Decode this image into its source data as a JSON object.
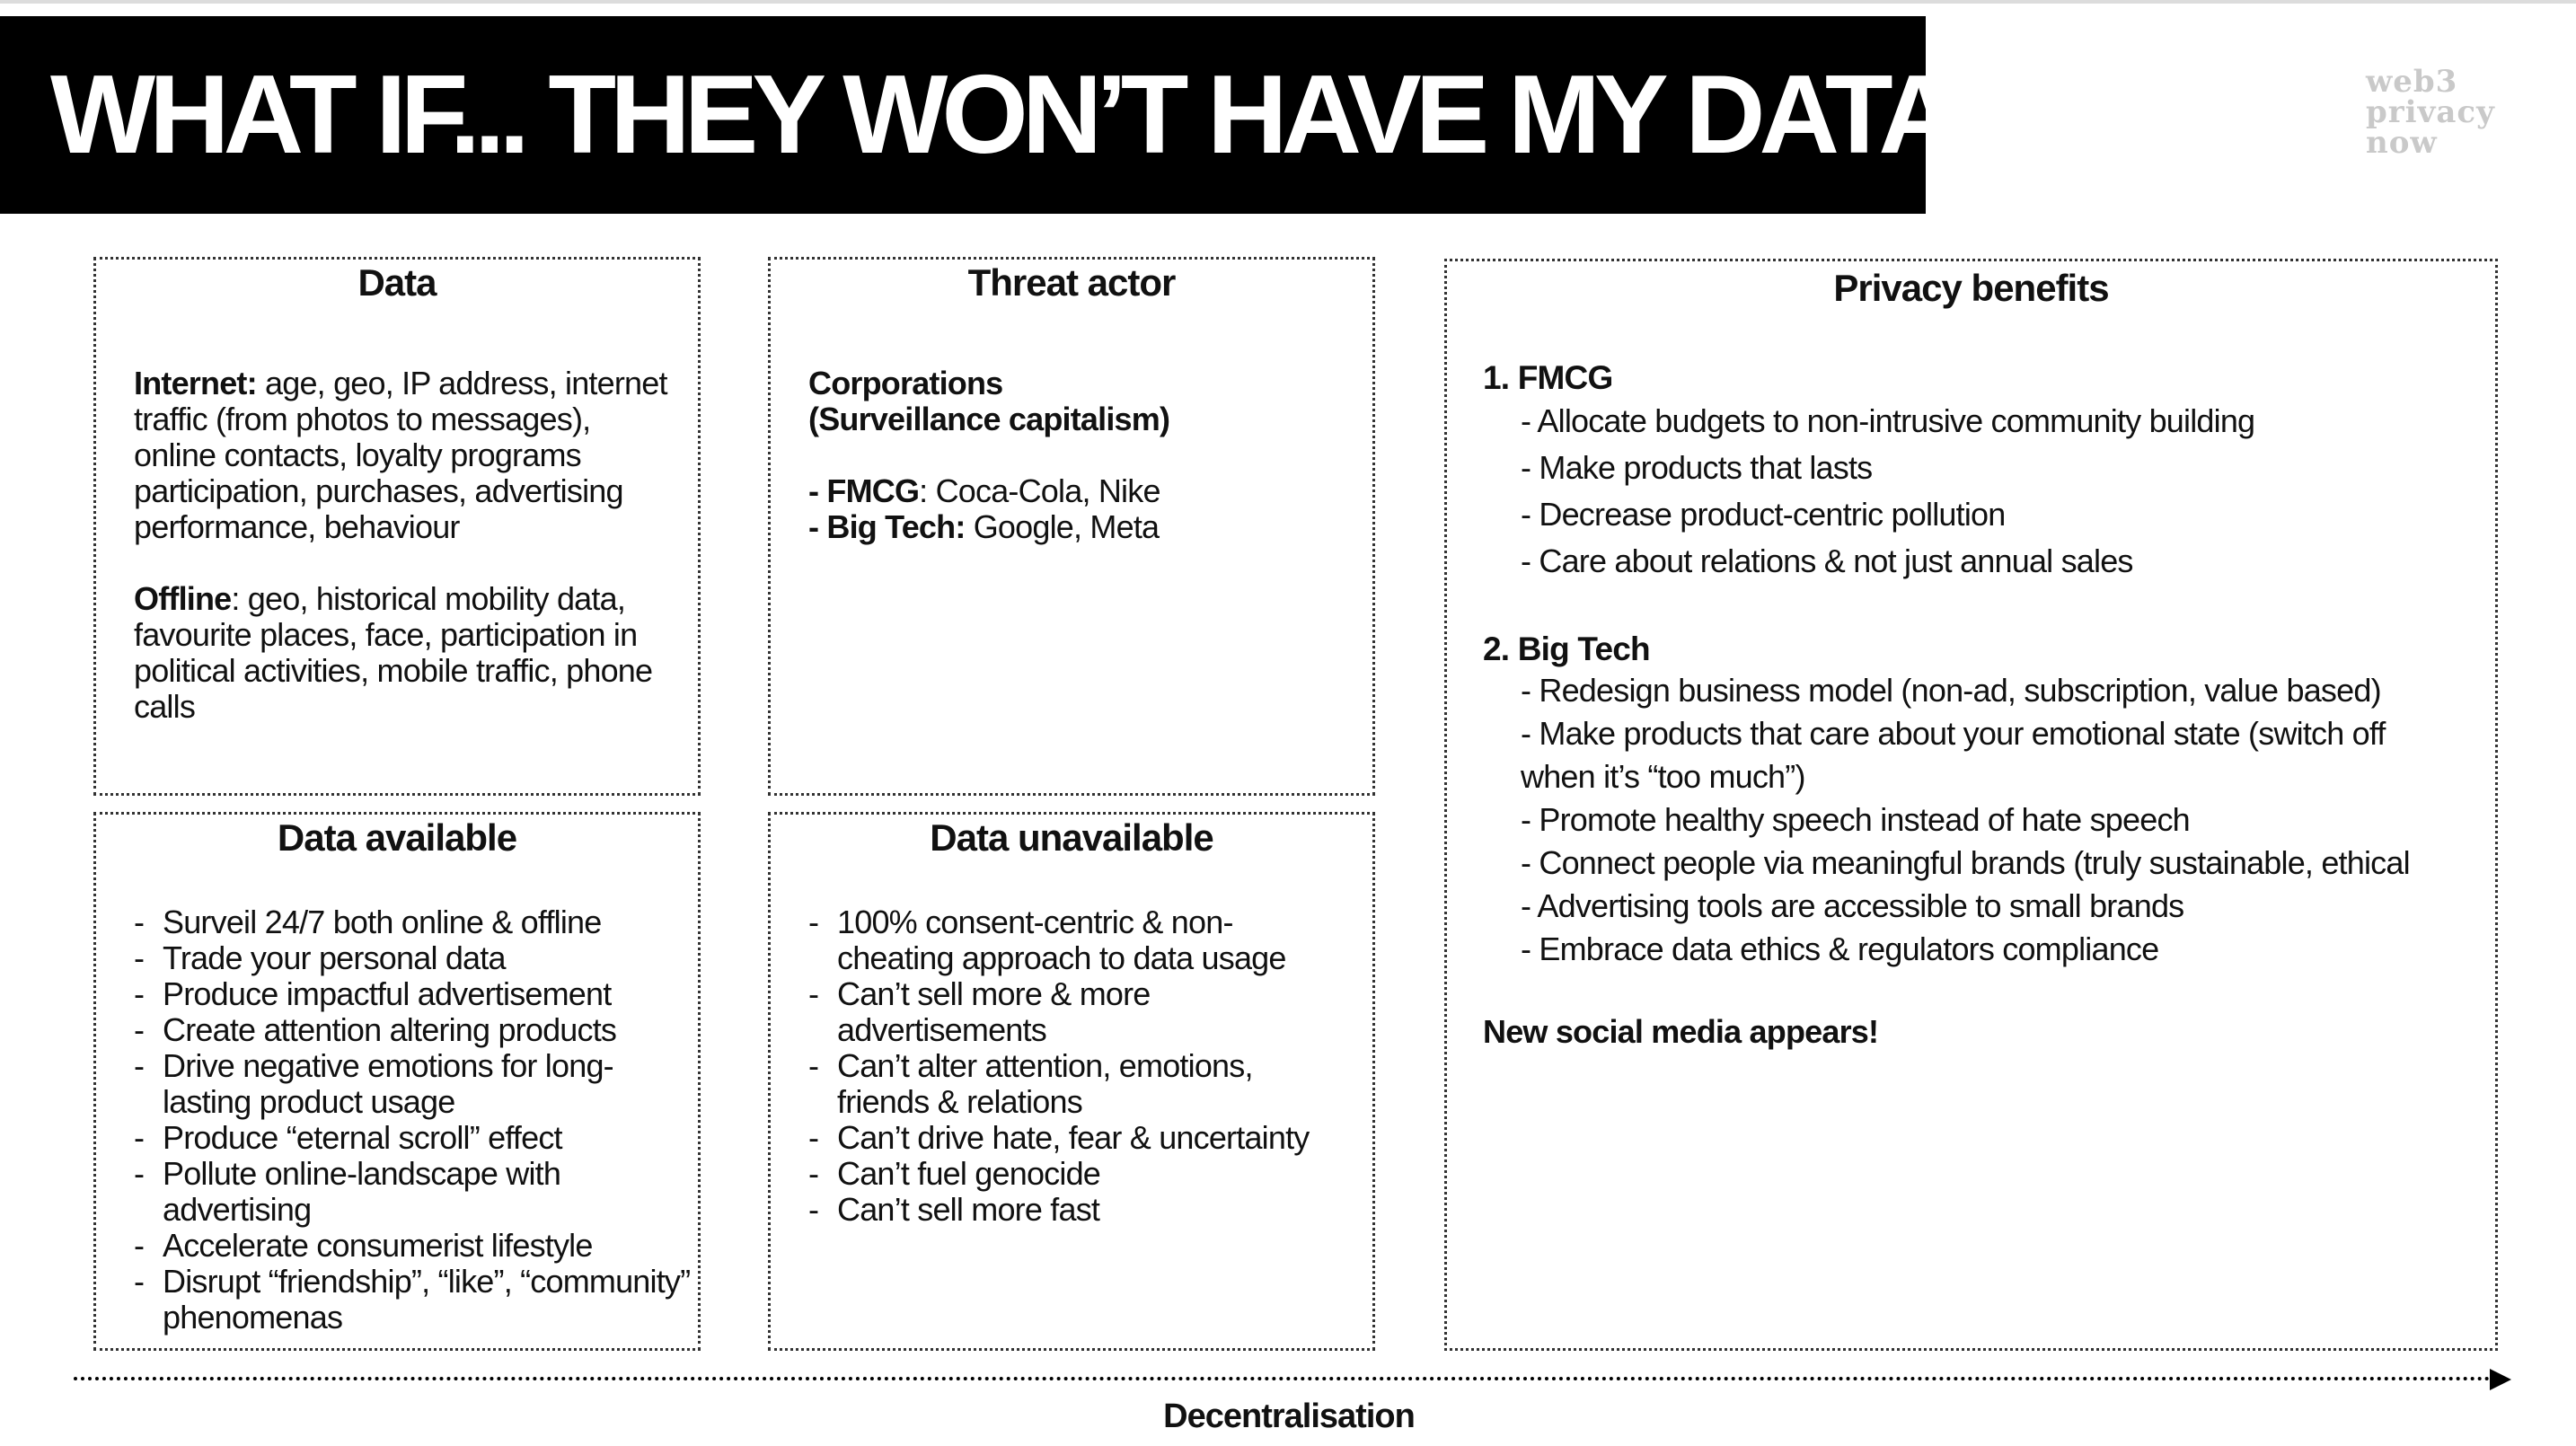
{
  "title": "WHAT IF... THEY WON’T HAVE MY DATA",
  "logo": {
    "lines": [
      "web3",
      "privacy",
      "now"
    ]
  },
  "data_box": {
    "title": "Data",
    "internet_label": "Internet:",
    "internet_text": " age, geo, IP address, internet traffic (from photos to messages), online contacts, loyalty programs participation, purchases, advertising performance, behaviour",
    "offline_label": "Offline",
    "offline_text": ": geo, historical mobility data, favourite places, face, participation in political activities, mobile traffic, phone calls"
  },
  "threat_box": {
    "title": "Threat actor",
    "heading_line1": "Corporations",
    "heading_line2": "(Surveillance capitalism)",
    "fmcg_label": "- FMCG",
    "fmcg_text": ": Coca-Cola, Nike",
    "bigtech_label": "- Big Tech:",
    "bigtech_text": " Google, Meta"
  },
  "data_available": {
    "title": "Data available",
    "items": [
      "Surveil 24/7 both online & offline",
      "Trade your personal data",
      "Produce impactful advertisement",
      "Create attention altering products",
      "Drive negative emotions for long-lasting product usage",
      "Produce “eternal scroll” effect",
      "Pollute online-landscape with advertising",
      "Accelerate consumerist lifestyle",
      "Disrupt “friendship”, “like”, “community” phenomenas"
    ]
  },
  "data_unavailable": {
    "title": "Data unavailable",
    "items": [
      "100% consent-centric & non-cheating approach to data usage",
      "Can’t sell more & more advertisements",
      "Can’t alter attention, emotions, friends & relations",
      "Can’t drive hate, fear & uncertainty",
      "Can’t fuel genocide",
      "Can’t sell more fast"
    ]
  },
  "privacy_benefits": {
    "title": "Privacy benefits",
    "fmcg_heading": "1.  FMCG",
    "fmcg_items": [
      "- Allocate budgets to non-intrusive community building",
      "- Make products that lasts",
      "- Decrease product-centric pollution",
      "- Care about relations & not just annual sales"
    ],
    "bigtech_heading": "2. Big Tech",
    "bigtech_items": [
      "- Redesign business model (non-ad, subscription, value based)",
      "- Make products that care about your emotional state (switch off when it’s “too much”)",
      "- Promote healthy speech instead of hate speech",
      "- Connect people via meaningful brands (truly sustainable, ethical",
      "- Advertising tools are accessible to small brands",
      "- Embrace data ethics & regulators compliance"
    ],
    "closing": "New social media appears!"
  },
  "axis_label": "Decentralisation"
}
